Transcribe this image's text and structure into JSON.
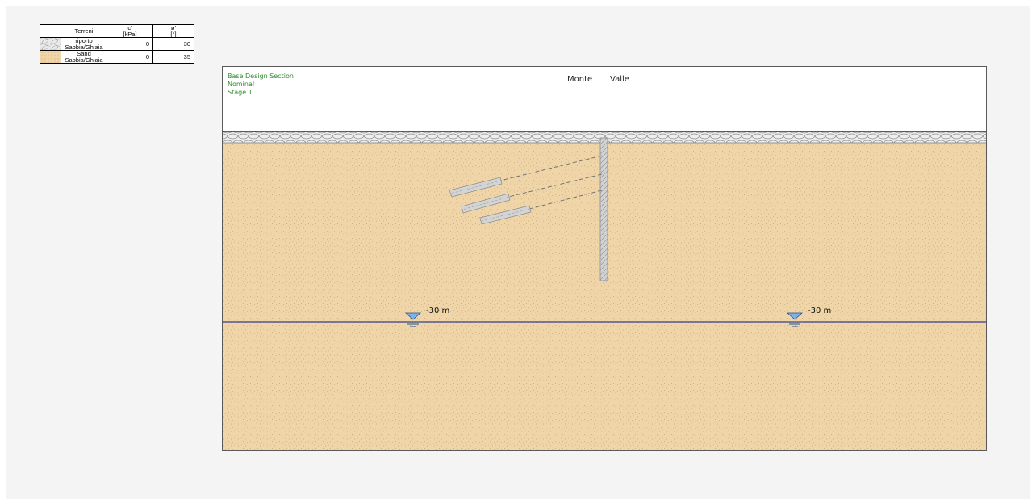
{
  "legend": {
    "headers": {
      "terreni": "Terreni",
      "c": "c'",
      "c_unit": "[kPa]",
      "phi": "ø'",
      "phi_unit": "[°]"
    },
    "rows": [
      {
        "name": "riporto",
        "type": "Sabbia/Ghiaia",
        "c": "0",
        "phi": "30",
        "swatch": "rubble-hatch"
      },
      {
        "name": "Sand",
        "type": "Sabbia/Ghiaia",
        "c": "0",
        "phi": "35",
        "swatch": "sand-dots"
      }
    ]
  },
  "section": {
    "info_lines": [
      "Base Design Section",
      "Nominal",
      "Stage 1"
    ],
    "monte": "Monte",
    "valle": "Valle",
    "water_table_left": "-30 m",
    "water_table_right": "-30 m"
  },
  "colors": {
    "sand": "#efd5a8",
    "fill_layer": "#ececec",
    "water_line": "#3a3a8a",
    "water_symbol": "#7fb2e6",
    "info_text": "#2e8b2e"
  }
}
